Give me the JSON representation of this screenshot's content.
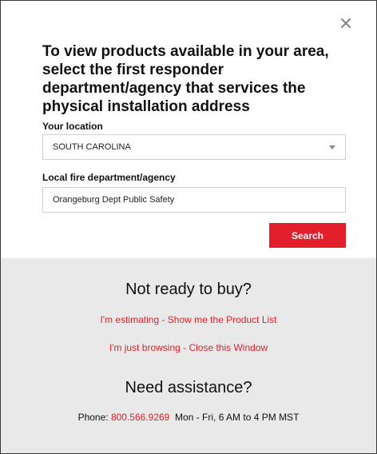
{
  "modal": {
    "headline": "To view products available in your area, select the first responder department/agency that services the physical installation address",
    "location_label": "Your location",
    "location_value": "SOUTH CAROLINA",
    "department_label": "Local fire department/agency",
    "department_value": "Orangeburg Dept Public Safety",
    "search_label": "Search"
  },
  "footer": {
    "not_ready_title": "Not ready to buy?",
    "estimating_link": "I'm estimating - Show me the Product List",
    "browsing_link": "I'm just browsing - Close this Window",
    "assistance_title": "Need assistance?",
    "phone_label": "Phone: ",
    "phone_number": "800.566.9269",
    "hours": "Mon - Fri, 6 AM to 4 PM MST"
  },
  "icons": {
    "close": "close-icon",
    "dropdown": "chevron-down-icon"
  },
  "colors": {
    "accent": "#e2202c",
    "panel_gray": "#e9e9e9",
    "text": "#111111"
  }
}
